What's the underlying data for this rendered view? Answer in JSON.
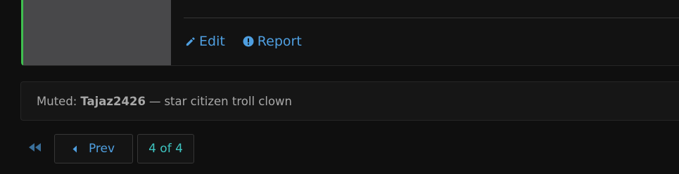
{
  "post": {
    "actions": [
      {
        "label": "Edit",
        "icon": "pencil-icon"
      },
      {
        "label": "Report",
        "icon": "alert-circle-icon"
      }
    ],
    "accent_color": "#3fbf4f"
  },
  "muted": {
    "prefix": "Muted:",
    "username": "Tajaz2426",
    "separator": "—",
    "reason": "star citizen troll clown"
  },
  "pagination": {
    "first_icon": "double-chevron-left-icon",
    "prev_label": "Prev",
    "prev_icon": "caret-left-icon",
    "current": "4 of 4"
  },
  "colors": {
    "link": "#4f9fe0",
    "page_indicator": "#3ec4c0"
  }
}
